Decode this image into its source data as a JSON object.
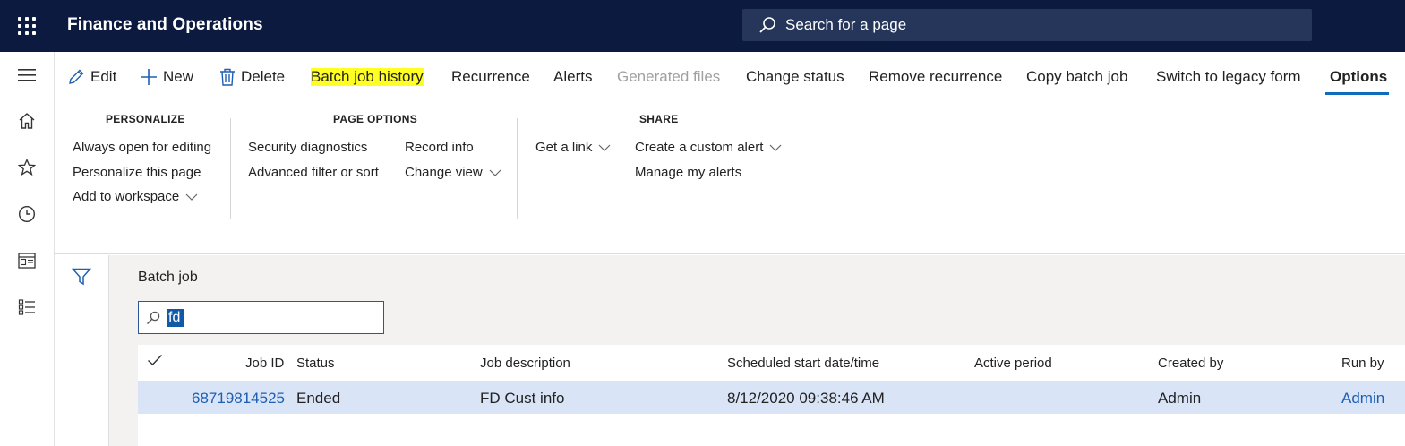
{
  "topbar": {
    "app_title": "Finance and Operations",
    "search_placeholder": "Search for a page"
  },
  "left_rail": {
    "items": [
      "menu-icon",
      "home-icon",
      "favorites-icon",
      "recent-icon",
      "workspaces-icon",
      "modules-icon"
    ]
  },
  "actions": {
    "edit": "Edit",
    "new": "New",
    "delete": "Delete",
    "batch_job_history": "Batch job history",
    "recurrence": "Recurrence",
    "alerts": "Alerts",
    "generated_files": "Generated files",
    "change_status": "Change status",
    "remove_recurrence": "Remove recurrence",
    "copy_batch_job": "Copy batch job",
    "switch_legacy": "Switch to legacy form",
    "options": "Options"
  },
  "options_pane": {
    "personalize": {
      "title": "PERSONALIZE",
      "items": [
        "Always open for editing",
        "Personalize this page",
        "Add to workspace"
      ]
    },
    "page_options": {
      "title": "PAGE OPTIONS",
      "items": [
        "Security diagnostics",
        "Advanced filter or sort",
        "Record info",
        "Change view"
      ]
    },
    "share": {
      "title": "SHARE",
      "items": [
        "Get a link",
        "Create a custom alert",
        "Manage my alerts"
      ]
    }
  },
  "content": {
    "section_label": "Batch job",
    "quick_filter_value": "fd",
    "grid": {
      "columns": [
        "Job ID",
        "Status",
        "Job description",
        "Scheduled start date/time",
        "Active period",
        "Created by",
        "Run by"
      ],
      "rows": [
        {
          "job_id": "68719814525",
          "status": "Ended",
          "description": "FD Cust info",
          "scheduled": "8/12/2020 09:38:46 AM",
          "active_period": "",
          "created_by": "Admin",
          "run_by": "Admin"
        }
      ]
    }
  },
  "colors": {
    "topbar_bg": "#0b1a3e",
    "accent": "#0f6cbd",
    "highlight": "#ffff24",
    "selected_row": "#d9e5f7",
    "link": "#1e5eb3"
  }
}
